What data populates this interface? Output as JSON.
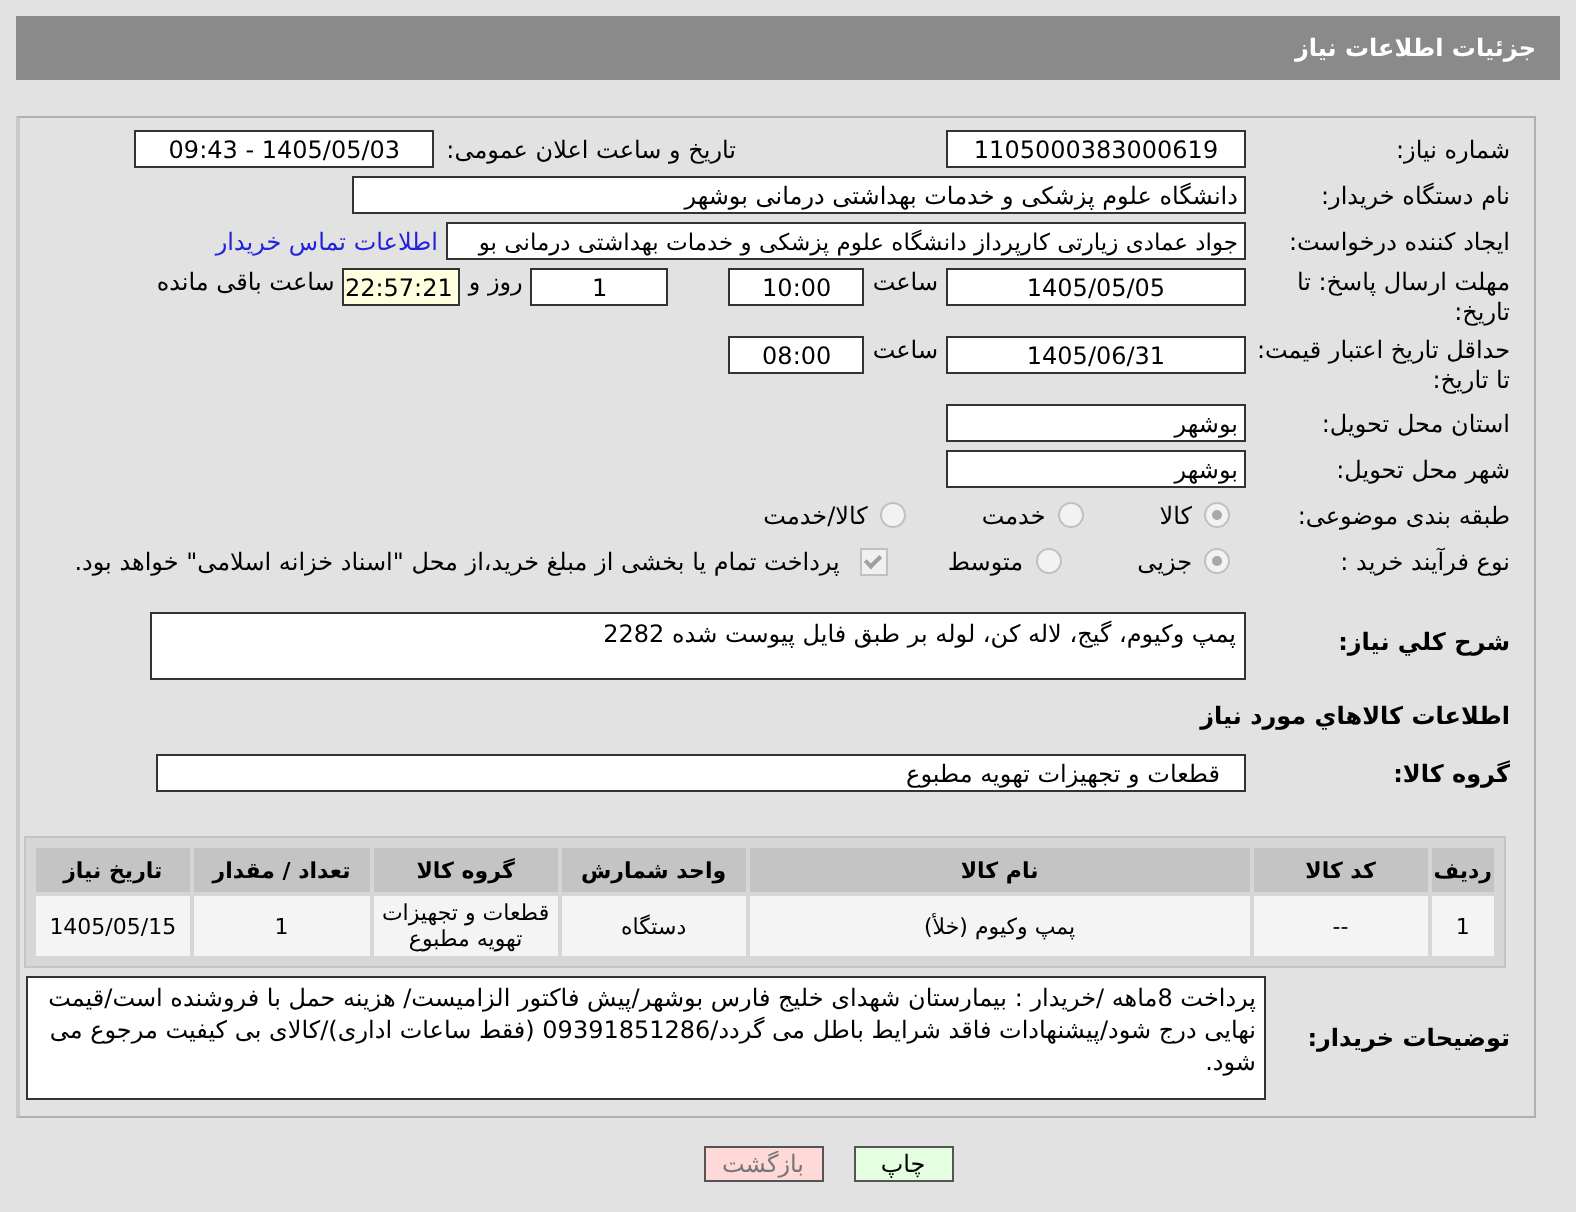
{
  "header": {
    "title": "جزئیات اطلاعات نیاز"
  },
  "need_number": {
    "label": "شماره نیاز:",
    "value": "1105000383000619"
  },
  "announce": {
    "label": "تاریخ و ساعت اعلان عمومی:",
    "value": "1405/05/03 - 09:43"
  },
  "buyer_org": {
    "label": "نام دستگاه خریدار:",
    "value": "دانشگاه علوم پزشکی و خدمات بهداشتی درمانی بوشهر"
  },
  "requester": {
    "label": "ایجاد کننده درخواست:",
    "value": "جواد عمادی زیارتی کارپرداز دانشگاه علوم پزشکی و خدمات بهداشتی درمانی بو",
    "link": "اطلاعات تماس خریدار"
  },
  "deadline": {
    "label": "مهلت ارسال پاسخ: تا تاریخ:",
    "date": "1405/05/05",
    "time_label": "ساعت",
    "time": "10:00",
    "days": "1",
    "days_label": "روز و",
    "remaining": "22:57:21",
    "remaining_label": "ساعت باقی مانده"
  },
  "validity": {
    "label": "حداقل تاریخ اعتبار قیمت: تا تاریخ:",
    "date": "1405/06/31",
    "time_label": "ساعت",
    "time": "08:00"
  },
  "province": {
    "label": "استان محل تحویل:",
    "value": "بوشهر"
  },
  "city": {
    "label": "شهر محل تحویل:",
    "value": "بوشهر"
  },
  "category": {
    "label": "طبقه بندی موضوعی:",
    "options": [
      {
        "label": "کالا",
        "selected": true
      },
      {
        "label": "خدمت",
        "selected": false
      },
      {
        "label": "کالا/خدمت",
        "selected": false
      }
    ]
  },
  "process": {
    "label": "نوع فرآیند خرید :",
    "options": [
      {
        "label": "جزیی",
        "selected": true
      },
      {
        "label": "متوسط",
        "selected": false
      }
    ],
    "treasury": {
      "checked": true,
      "text": "پرداخت تمام یا بخشی از مبلغ خرید،از محل \"اسناد خزانه اسلامی\" خواهد بود."
    }
  },
  "description": {
    "label": "شرح کلي نياز:",
    "value": "پمپ وکیوم، گیج، لاله کن، لوله بر طبق فایل پیوست شده 2282"
  },
  "goods_title": "اطلاعات کالاهاي مورد نياز",
  "goods_group": {
    "label": "گروه کالا:",
    "value": "قطعات و تجهیزات تهویه مطبوع"
  },
  "table": {
    "columns": [
      "ردیف",
      "کد کالا",
      "نام کالا",
      "واحد شمارش",
      "گروه کالا",
      "تعداد / مقدار",
      "تاریخ نیاز"
    ],
    "rows": [
      [
        "1",
        "--",
        "پمپ وکیوم (خلأ)",
        "دستگاه",
        "قطعات و تجهیزات تهویه مطبوع",
        "1",
        "1405/05/15"
      ]
    ]
  },
  "buyer_notes": {
    "label": "توضیحات خریدار:",
    "value": "پرداخت 8ماهه /خریدار : بیمارستان شهدای خلیج فارس بوشهر/پیش فاکتور الزامیست/ هزینه حمل با فروشنده است/قیمت نهایی درج شود/پیشنهادات فاقد شرایط باطل می گردد/09391851286 (فقط ساعات اداری)/کالای بی کیفیت مرجوع می شود."
  },
  "buttons": [
    {
      "kind": "print",
      "label": "چاپ"
    },
    {
      "kind": "back",
      "label": "بازگشت"
    }
  ]
}
